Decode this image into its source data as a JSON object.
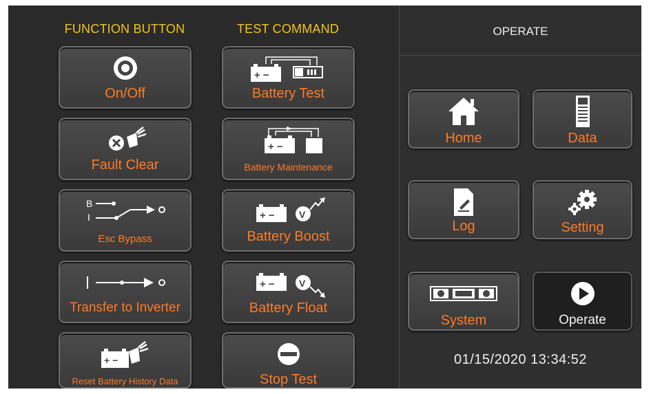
{
  "headers": {
    "function_button": "FUNCTION BUTTON",
    "test_command": "TEST COMMAND",
    "operate": "OPERATE"
  },
  "function_buttons": [
    {
      "label": "On/Off",
      "icon": "power-icon"
    },
    {
      "label": "Fault Clear",
      "icon": "fault-clear-icon"
    },
    {
      "label": "Esc Bypass",
      "icon": "bypass-switch-icon"
    },
    {
      "label": "Transfer to Inverter",
      "icon": "transfer-icon"
    },
    {
      "label": "Reset Battery History Data",
      "icon": "battery-broom-icon"
    }
  ],
  "test_commands": [
    {
      "label": "Battery Test",
      "icon": "battery-test-icon"
    },
    {
      "label": "Battery Maintenance",
      "icon": "battery-maintenance-icon"
    },
    {
      "label": "Battery Boost",
      "icon": "battery-boost-icon"
    },
    {
      "label": "Battery Float",
      "icon": "battery-float-icon"
    },
    {
      "label": "Stop Test",
      "icon": "stop-icon"
    }
  ],
  "operate_buttons": [
    {
      "label": "Home",
      "icon": "home-icon"
    },
    {
      "label": "Data",
      "icon": "data-icon"
    },
    {
      "label": "Log",
      "icon": "log-icon"
    },
    {
      "label": "Setting",
      "icon": "gear-icon"
    },
    {
      "label": "System",
      "icon": "system-icon"
    },
    {
      "label": "Operate",
      "icon": "play-icon"
    }
  ],
  "bypass_letters": {
    "b": "B",
    "i": "I"
  },
  "datetime": "01/15/2020  13:34:52",
  "colors": {
    "accent_label": "#ff7a26",
    "header": "#f3c51f",
    "background": "#2a2a2a"
  }
}
